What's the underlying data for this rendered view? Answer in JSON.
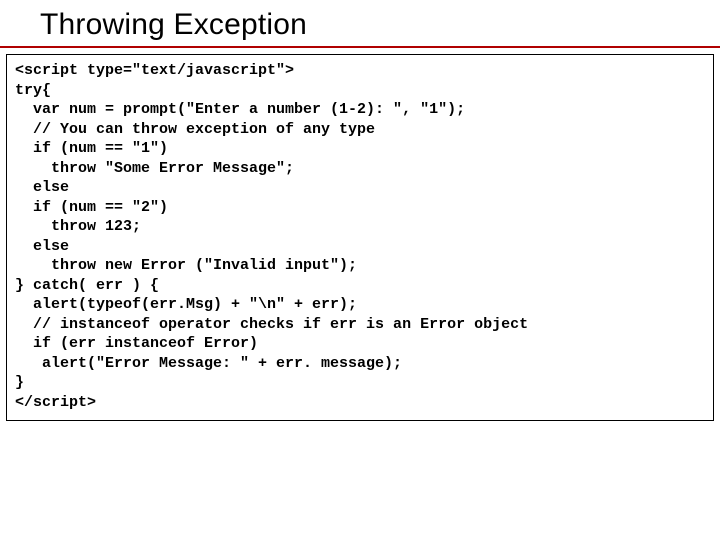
{
  "title": "Throwing Exception",
  "code": "<script type=\"text/javascript\">\ntry{\n  var num = prompt(\"Enter a number (1-2): \", \"1\");\n  // You can throw exception of any type\n  if (num == \"1\")\n    throw \"Some Error Message\";\n  else\n  if (num == \"2\")\n    throw 123;\n  else\n    throw new Error (\"Invalid input\");\n} catch( err ) {\n  alert(typeof(err.Msg) + \"\\n\" + err);\n  // instanceof operator checks if err is an Error object\n  if (err instanceof Error)\n   alert(\"Error Message: \" + err. message);\n}\n</script>"
}
